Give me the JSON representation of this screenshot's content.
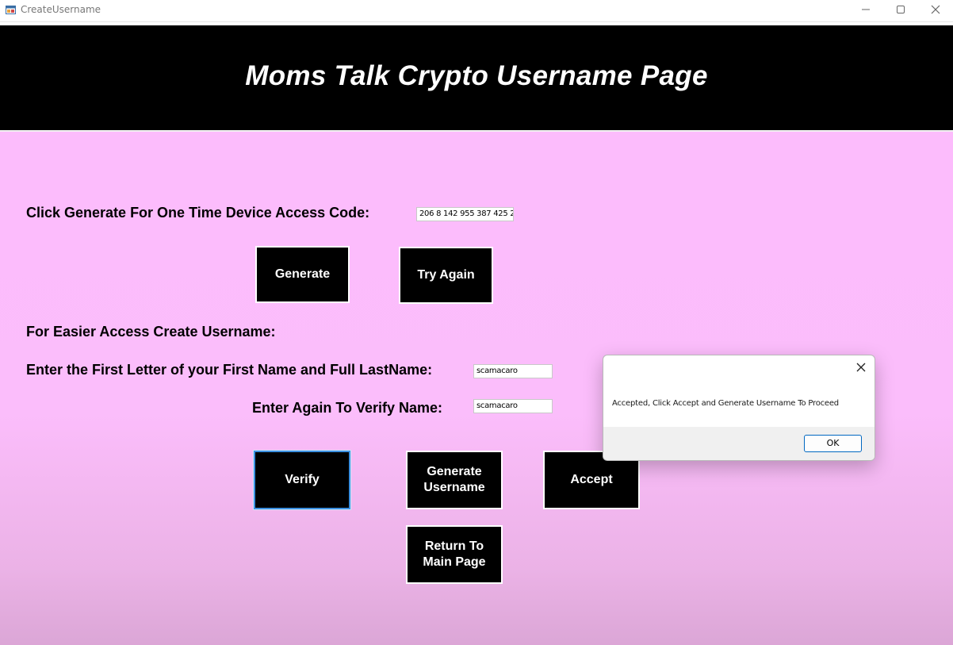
{
  "window": {
    "title": "CreateUsername"
  },
  "header": {
    "title": "Moms Talk Crypto Username Page"
  },
  "access_code": {
    "label": "Click Generate For One Time Device Access Code:",
    "value": "206 8 142 955 387 425 2"
  },
  "buttons": {
    "generate": "Generate",
    "try_again": "Try Again",
    "verify": "Verify",
    "generate_username": "Generate\nUsername",
    "accept": "Accept",
    "return_main": "Return To\nMain Page"
  },
  "username": {
    "section_label": "For Easier Access Create Username:",
    "first_label": "Enter the First Letter of your First Name and Full LastName:",
    "first_value": "scamacaro",
    "verify_label": "Enter Again To Verify Name:",
    "verify_value": "scamacaro"
  },
  "dialog": {
    "message": "Accepted, Click Accept and Generate Username To Proceed",
    "ok_label": "OK"
  },
  "icons": {
    "app": "app-window-icon",
    "minimize": "minimize-icon",
    "maximize": "maximize-icon",
    "close": "close-icon",
    "dialog_close": "dialog-close-icon"
  },
  "colors": {
    "header_bg": "#000000",
    "content_bg": "#fcbcfc",
    "button_bg": "#000000",
    "focus_border": "#3a8fe0",
    "ok_border": "#0067c0"
  }
}
